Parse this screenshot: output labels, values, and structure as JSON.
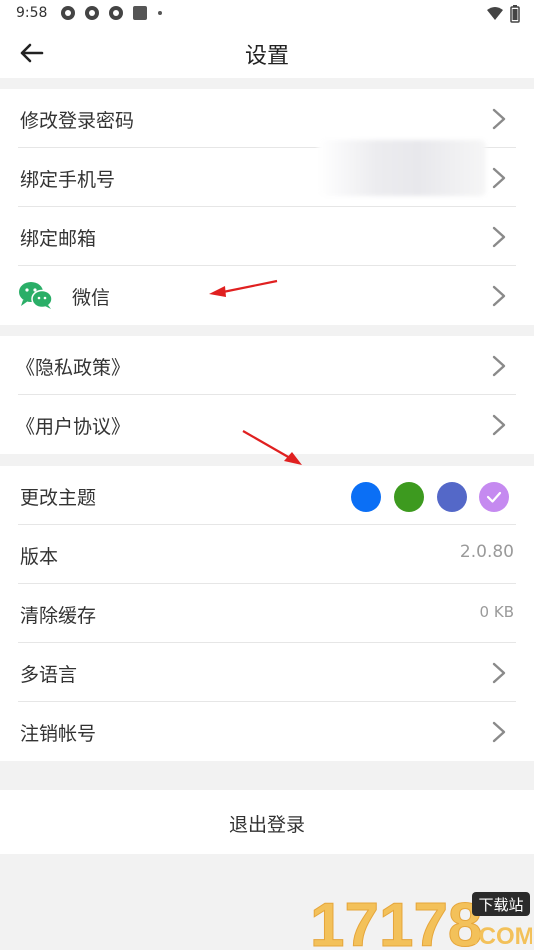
{
  "status_bar": {
    "time": "9:58"
  },
  "header": {
    "title": "设置"
  },
  "account_group": [
    {
      "label": "修改登录密码"
    },
    {
      "label": "绑定手机号"
    },
    {
      "label": "绑定邮箱"
    },
    {
      "label": "微信",
      "icon": "wechat-icon"
    }
  ],
  "policy_group": [
    {
      "label": "《隐私政策》"
    },
    {
      "label": "《用户协议》"
    }
  ],
  "settings_group": {
    "theme": {
      "label": "更改主题",
      "colors": [
        "#0b6ff5",
        "#3d9a1f",
        "#5468c8",
        "#c58af0"
      ],
      "selected_index": 3
    },
    "version": {
      "label": "版本",
      "value": "2.0.80"
    },
    "cache": {
      "label": "清除缓存",
      "value": "0 KB"
    },
    "language": {
      "label": "多语言"
    },
    "delete_account": {
      "label": "注销帐号"
    }
  },
  "logout": {
    "label": "退出登录"
  },
  "watermark": {
    "text": "17178",
    "badge": "下载站",
    "suffix": ".COM"
  },
  "colors": {
    "accent_arrow": "#e02020",
    "wechat": "#2aae67"
  }
}
